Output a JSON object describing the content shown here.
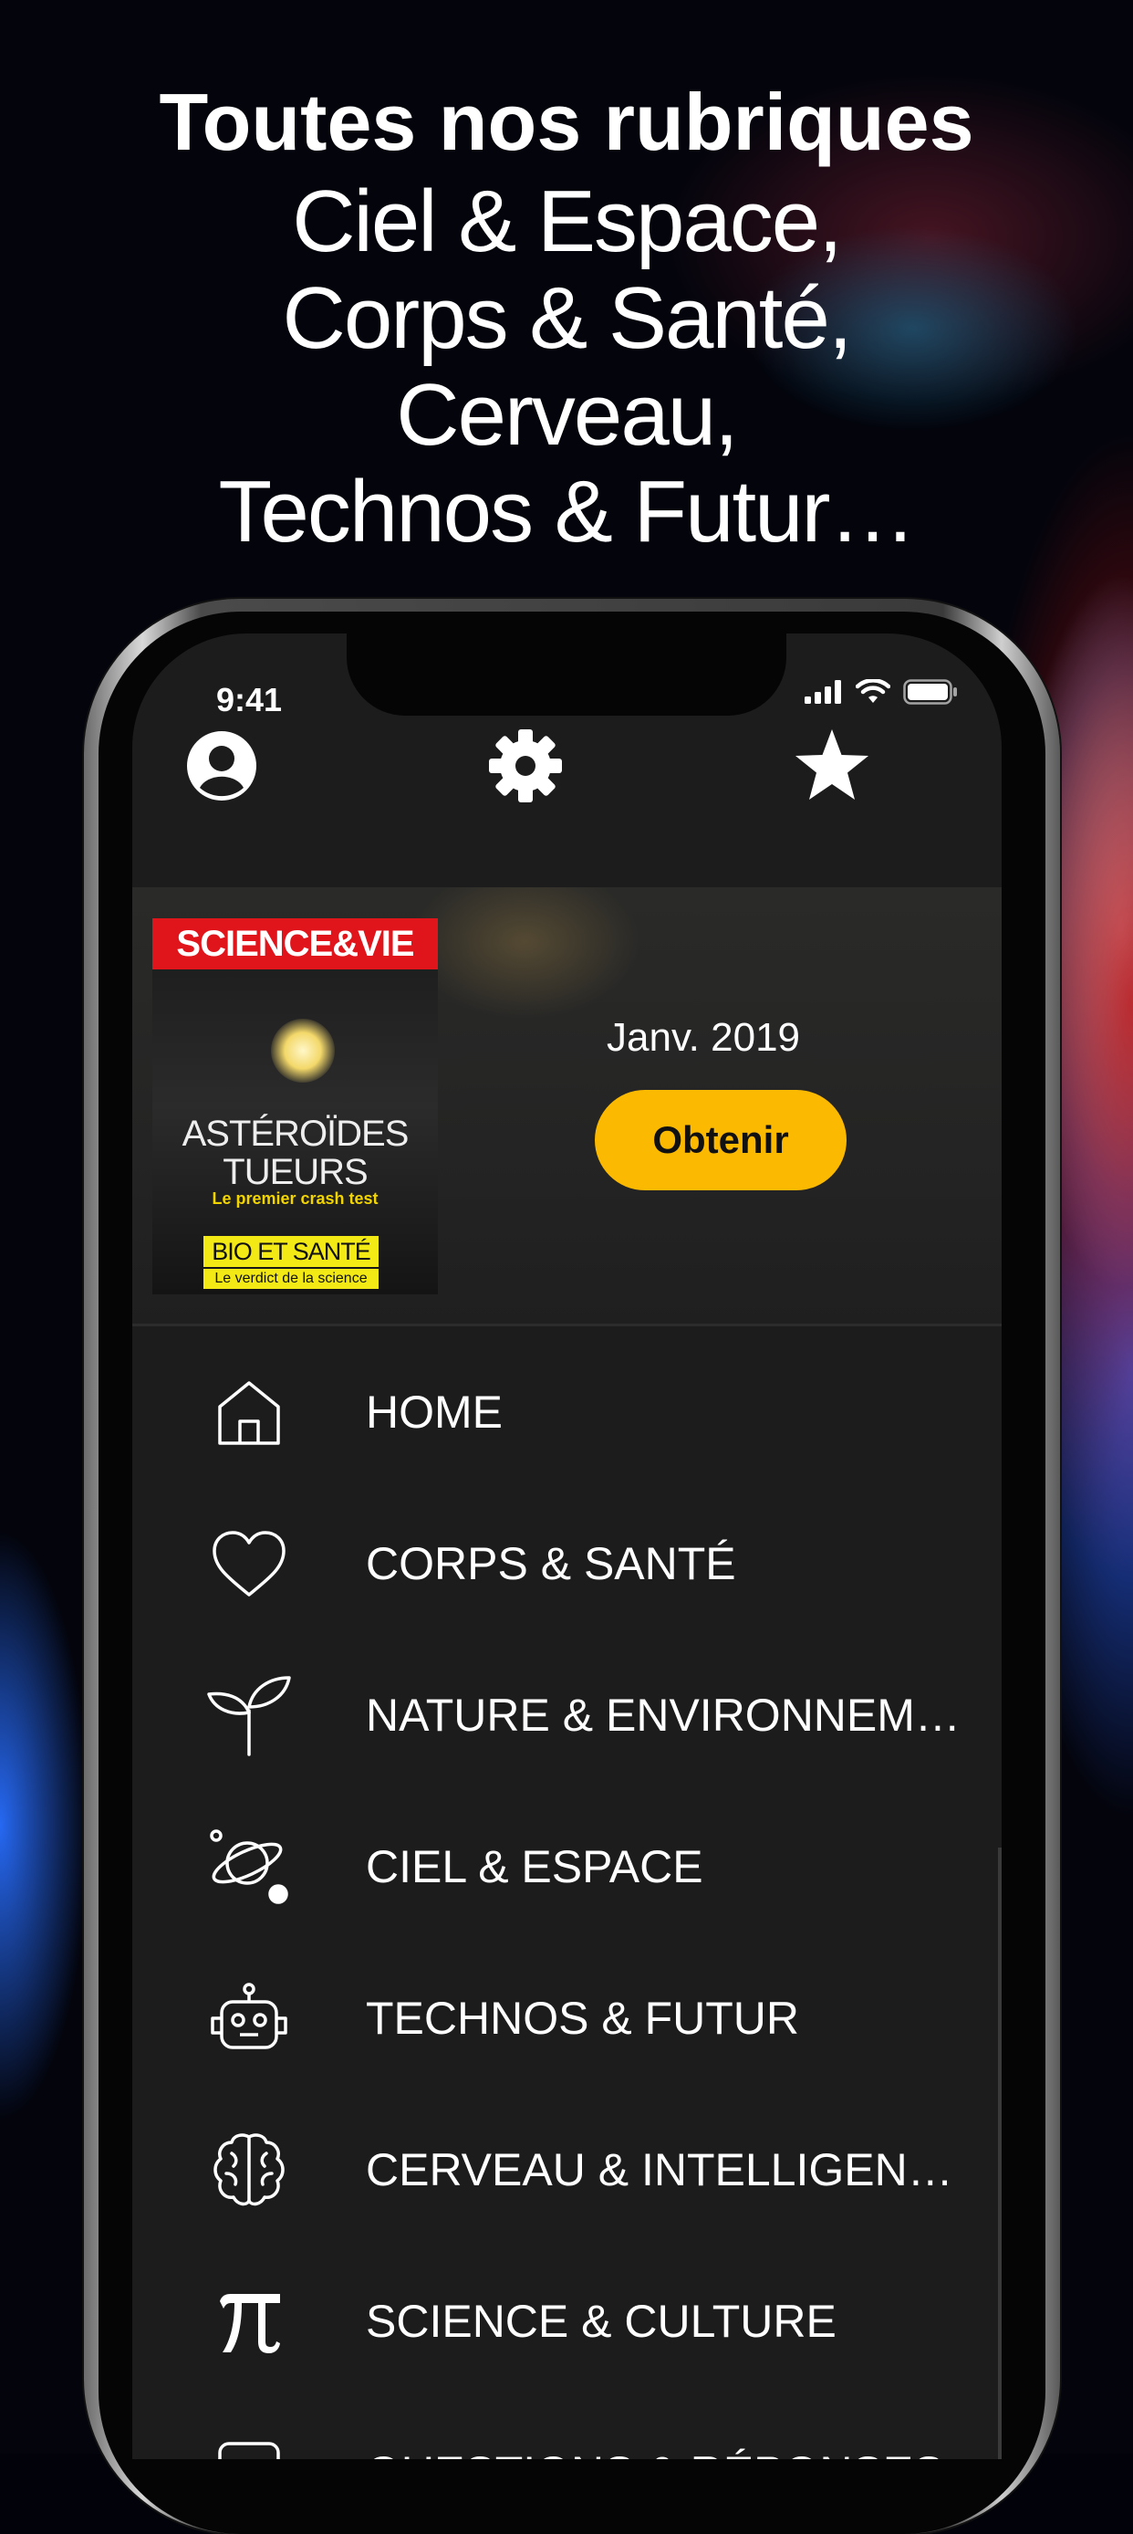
{
  "headline": {
    "bold": "Toutes nos rubriques",
    "lines": [
      "Ciel & Espace,",
      "Corps & Santé,",
      "Cerveau,",
      "Technos & Futur…"
    ]
  },
  "status_bar": {
    "time": "9:41"
  },
  "topbar": {
    "icons": [
      "profile-icon",
      "gear-icon",
      "star-icon"
    ]
  },
  "featured_issue": {
    "cover": {
      "brand": "SCIENCE&VIE",
      "headline": "ASTÉROÏDES TUEURS",
      "subheadline": "Le premier crash test",
      "banner": "BIO ET SANTÉ",
      "banner_sub": "Le verdict de la science"
    },
    "date": "Janv. 2019",
    "button_label": "Obtenir"
  },
  "menu": {
    "items": [
      {
        "label": "HOME",
        "icon": "home-icon"
      },
      {
        "label": "CORPS & SANTÉ",
        "icon": "heart-icon"
      },
      {
        "label": "NATURE & ENVIRONNEM…",
        "icon": "sprout-icon"
      },
      {
        "label": "CIEL & ESPACE",
        "icon": "planet-icon"
      },
      {
        "label": "TECHNOS & FUTUR",
        "icon": "robot-icon"
      },
      {
        "label": "CERVEAU & INTELLIGEN…",
        "icon": "brain-icon"
      },
      {
        "label": "SCIENCE & CULTURE",
        "icon": "pi-icon"
      },
      {
        "label": "QUESTIONS & RÉPONSES",
        "icon": "question-icon"
      }
    ]
  },
  "colors": {
    "accent": "#fbb901",
    "screen_bg": "#1c1c1d",
    "brand_red": "#e0151c"
  }
}
